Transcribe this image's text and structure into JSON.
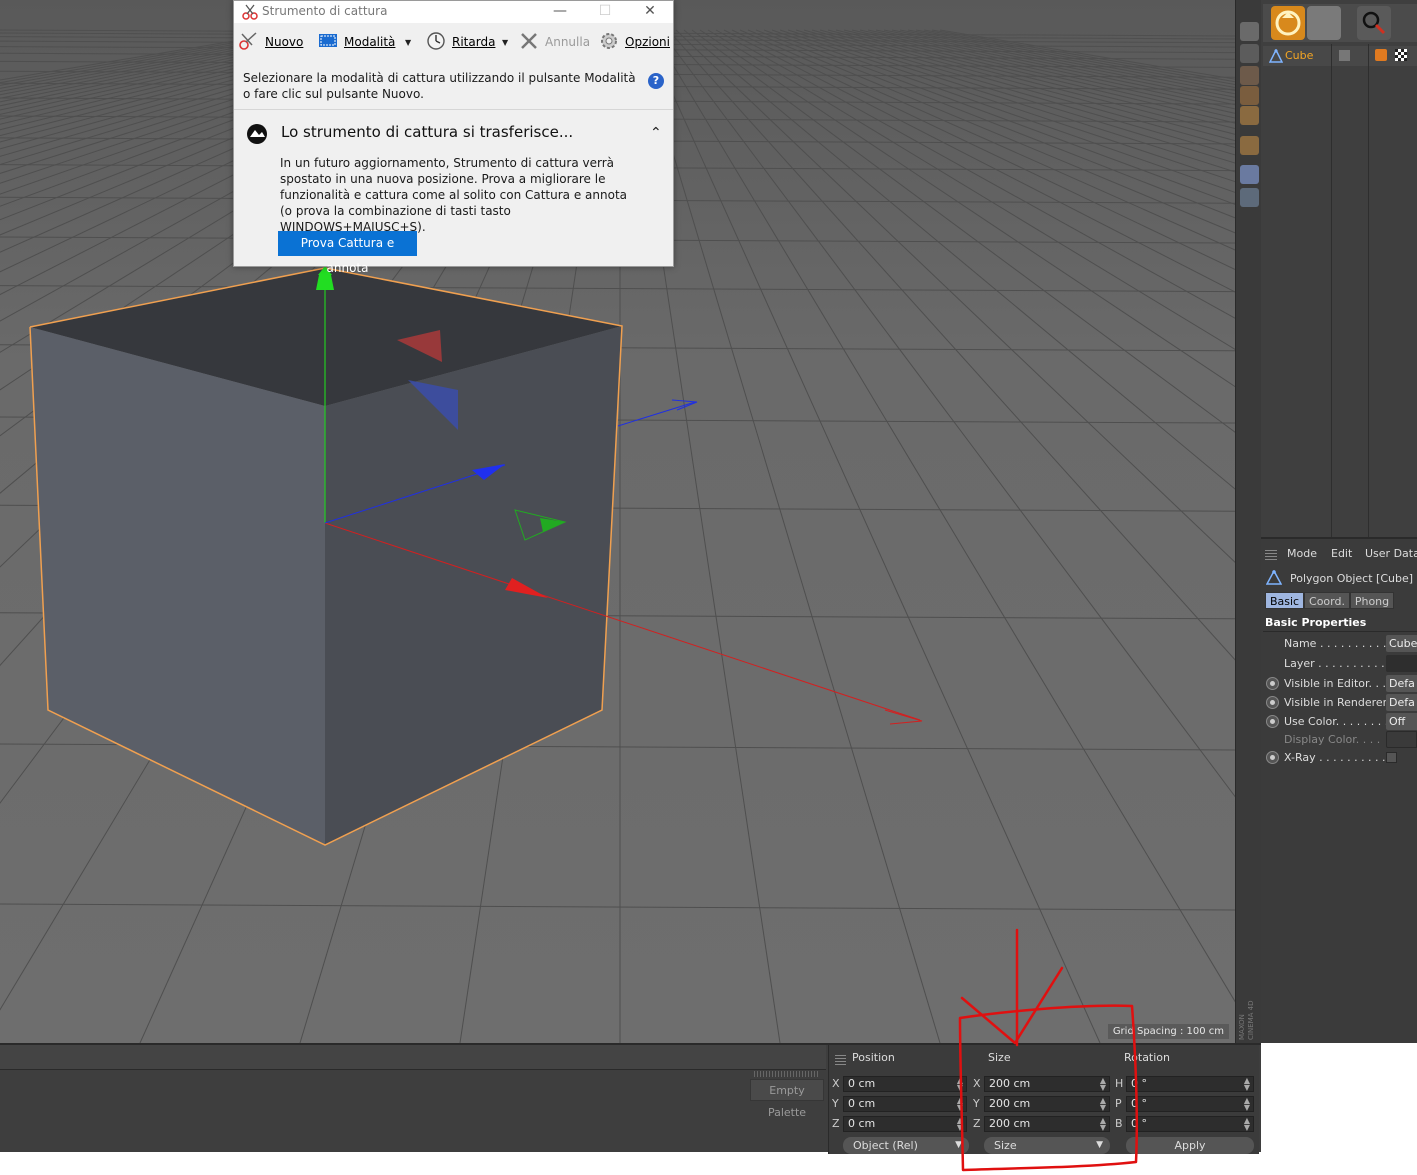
{
  "snipping_tool": {
    "title": "Strumento di cattura",
    "toolbar": {
      "new_label": "Nuovo",
      "mode_label": "Modalità",
      "delay_label": "Ritarda",
      "cancel_label": "Annulla",
      "options_label": "Opzioni"
    },
    "instruction": "Selezionare la modalità di cattura utilizzando il pulsante Modalità o fare clic sul pulsante Nuovo.",
    "help_glyph": "?",
    "notice": {
      "title": "Lo strumento di cattura si trasferisce...",
      "body": "In un futuro aggiornamento, Strumento di cattura verrà spostato in una nuova posizione. Prova a migliorare le funzionalità e cattura come al solito con Cattura e annota (o prova la combinazione di tasti tasto WINDOWS+MAIUSC+S).",
      "button_label": "Prova Cattura e annota"
    }
  },
  "viewport": {
    "grid_spacing": "Grid Spacing : 100 cm",
    "axis_colors": {
      "x": "#e02020",
      "y": "#22cc22",
      "z": "#2030e0"
    },
    "selection_color": "#f0a050"
  },
  "maxon_logo": "MAXON CINEMA 4D",
  "object_manager": {
    "objects": [
      {
        "name": "Cube",
        "icon": "polygon-object-icon"
      }
    ]
  },
  "attributes": {
    "menu": [
      "Mode",
      "Edit",
      "User Data"
    ],
    "object_title": "Polygon Object [Cube]",
    "tabs": [
      "Basic",
      "Coord.",
      "Phong"
    ],
    "active_tab": "Basic",
    "section": "Basic Properties",
    "properties": [
      {
        "label": "Name . . . . . . . . . . . .",
        "value": "Cube"
      },
      {
        "label": "Layer . . . . . . . . . . . .",
        "value": ""
      },
      {
        "label": "Visible in Editor. . .",
        "value": "Defa"
      },
      {
        "label": "Visible in Renderer",
        "value": "Defa"
      },
      {
        "label": "Use Color. . . . . . . .",
        "value": "Off"
      },
      {
        "label": "Display Color. . . .",
        "value": ""
      },
      {
        "label": "X-Ray . . . . . . . . . . .",
        "value": ""
      }
    ]
  },
  "bottom": {
    "palette_label": "Empty Palette"
  },
  "coordinates": {
    "headers": {
      "position": "Position",
      "size": "Size",
      "rotation": "Rotation"
    },
    "position_axes": [
      "X",
      "Y",
      "Z"
    ],
    "size_axes": [
      "X",
      "Y",
      "Z"
    ],
    "rotation_axes": [
      "H",
      "P",
      "B"
    ],
    "position": [
      "0 cm",
      "0 cm",
      "0 cm"
    ],
    "size": [
      "200 cm",
      "200 cm",
      "200 cm"
    ],
    "rotation": [
      "0 °",
      "0 °",
      "0 °"
    ],
    "mode_dropdown": "Object (Rel)",
    "size_dropdown": "Size",
    "apply_label": "Apply"
  }
}
